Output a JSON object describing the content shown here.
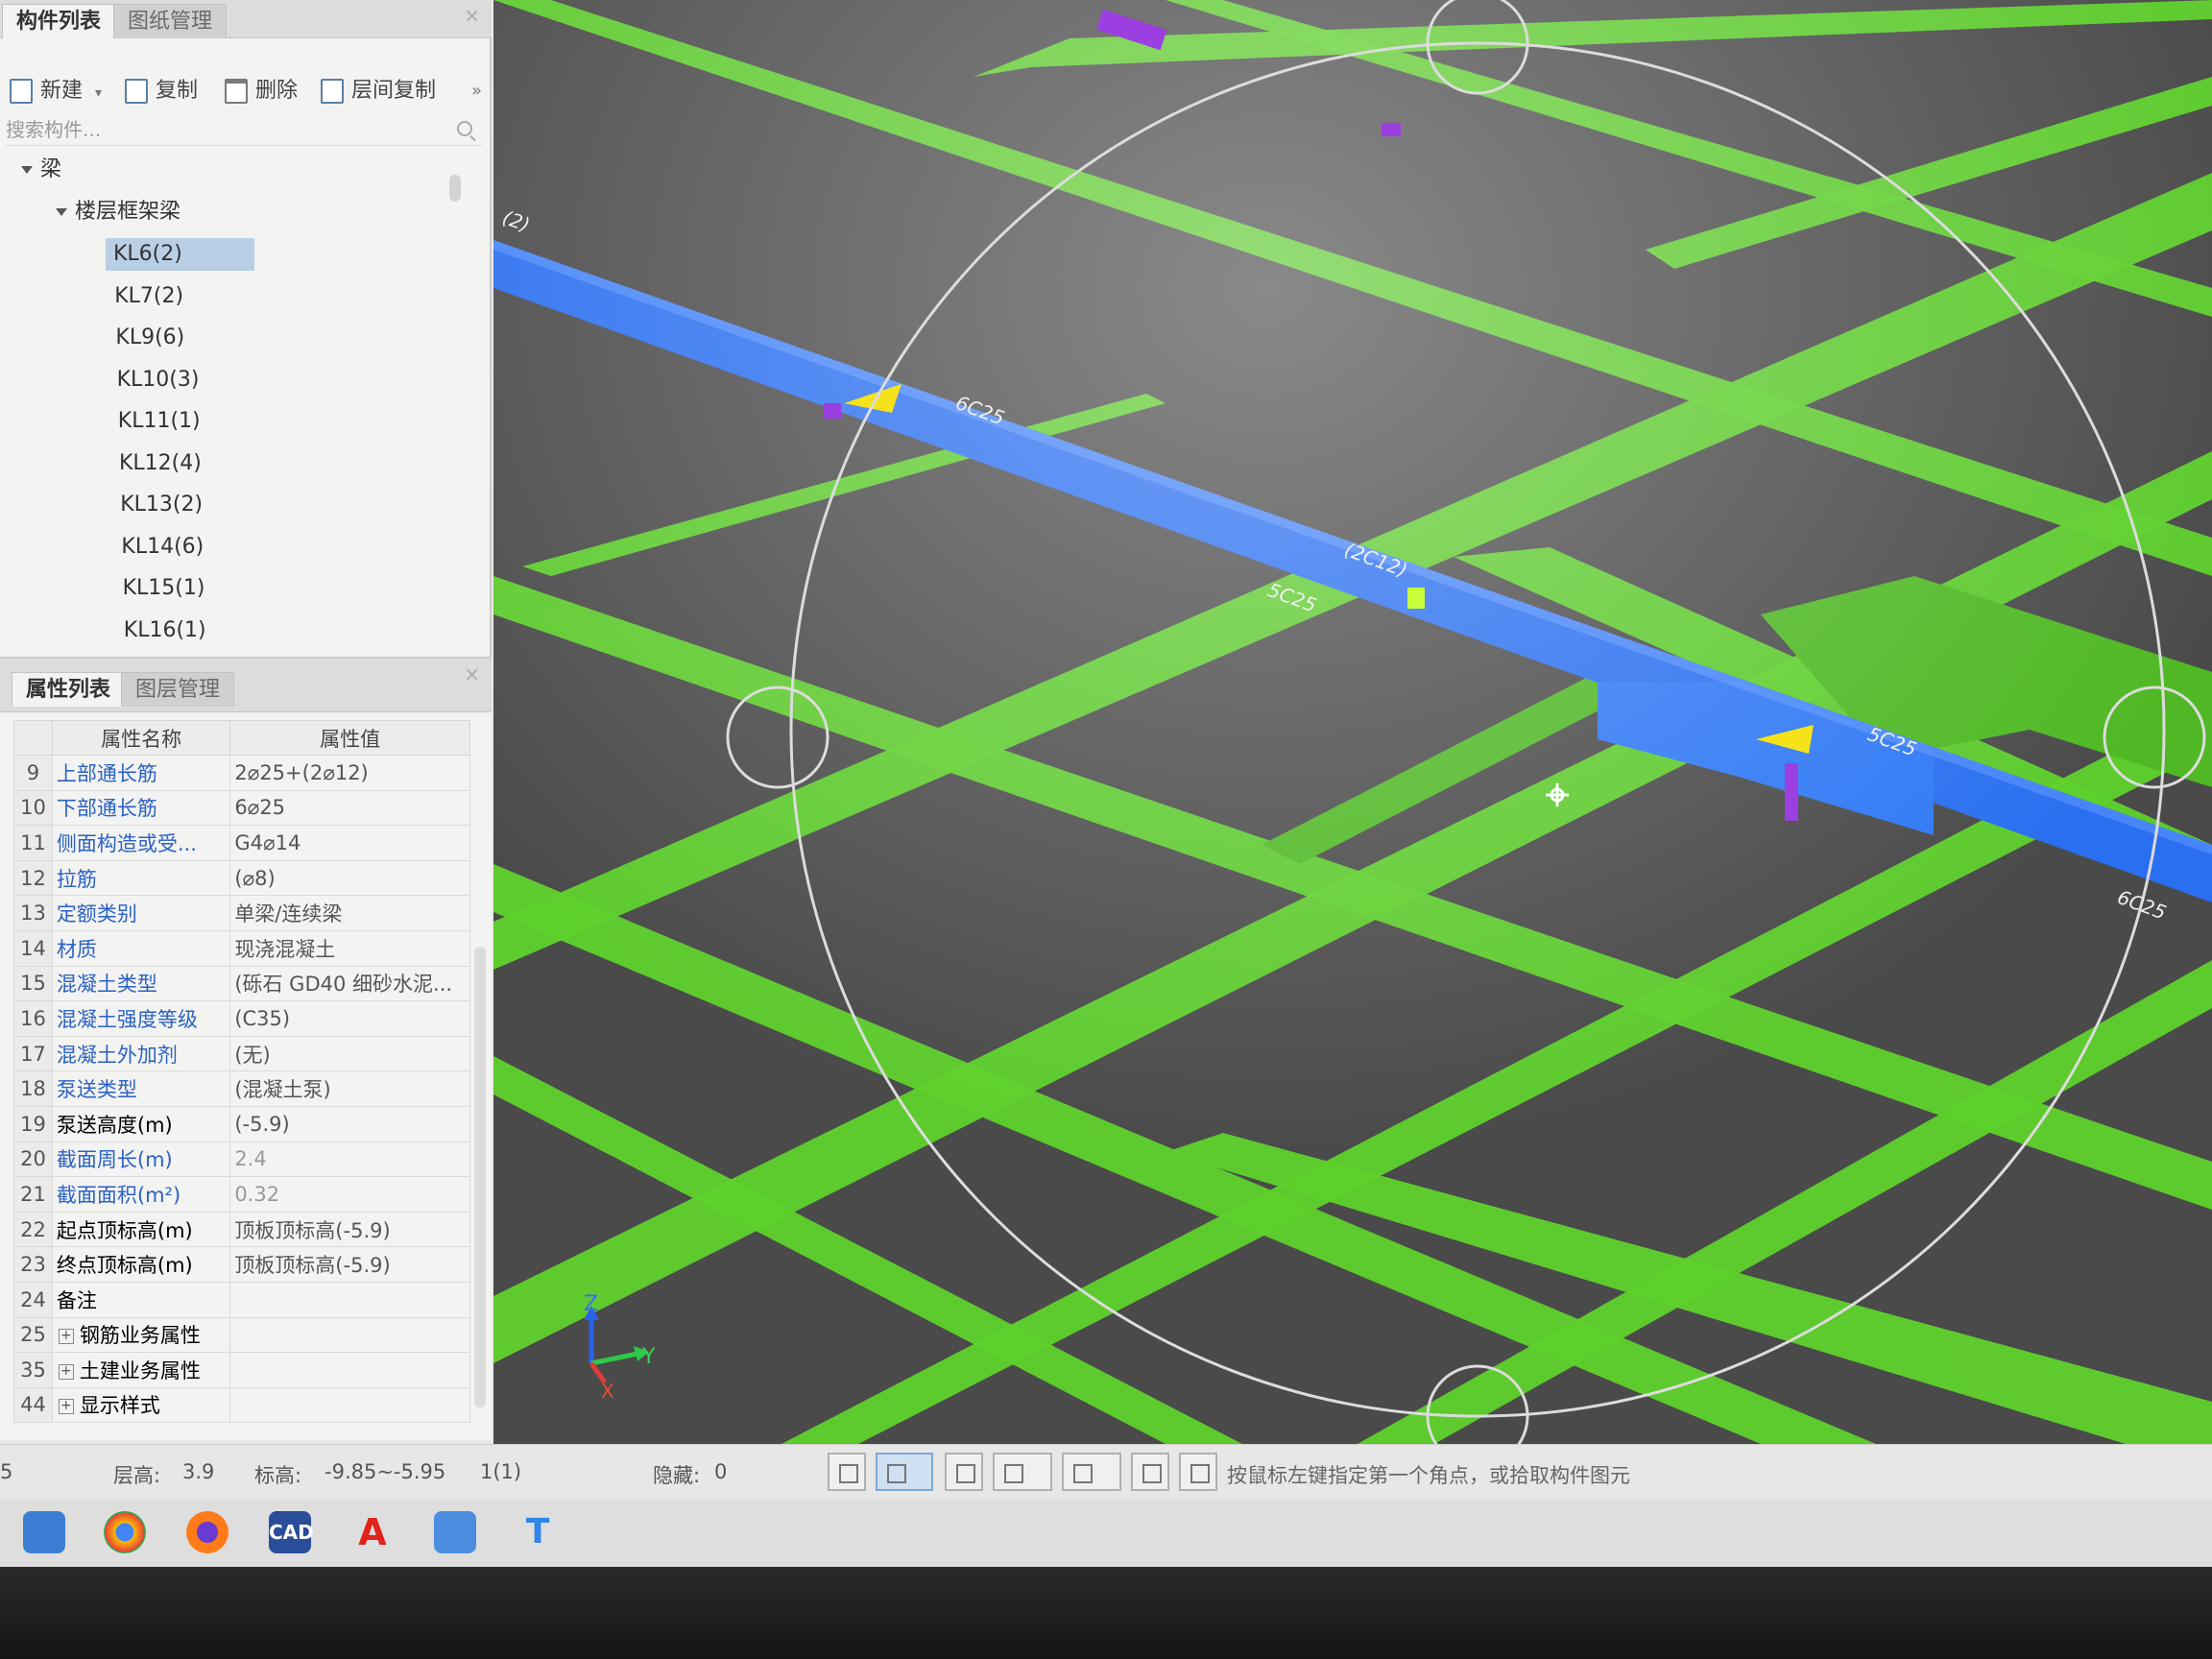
{
  "components_panel": {
    "tabs": [
      "构件列表",
      "图纸管理"
    ],
    "toolbar": {
      "new_label": "新建",
      "copy_label": "复制",
      "delete_label": "删除",
      "floor_copy_label": "层间复制"
    },
    "search_placeholder": "搜索构件...",
    "tree": {
      "root_label": "梁",
      "group_label": "楼层框架梁",
      "items": [
        "KL6(2)",
        "KL7(2)",
        "KL9(6)",
        "KL10(3)",
        "KL11(1)",
        "KL12(4)",
        "KL13(2)",
        "KL14(6)",
        "KL15(1)",
        "KL16(1)"
      ],
      "selected_index": 0
    }
  },
  "properties_panel": {
    "tabs": [
      "属性列表",
      "图层管理"
    ],
    "columns": [
      "属性名称",
      "属性值"
    ],
    "rows": [
      {
        "num": "9",
        "name": "上部通长筋",
        "value": "2⌀25+(2⌀12)",
        "link": true
      },
      {
        "num": "10",
        "name": "下部通长筋",
        "value": "6⌀25",
        "link": true
      },
      {
        "num": "11",
        "name": "侧面构造或受...",
        "value": "G4⌀14",
        "link": true
      },
      {
        "num": "12",
        "name": "拉筋",
        "value": "(⌀8)",
        "link": true
      },
      {
        "num": "13",
        "name": "定额类别",
        "value": "单梁/连续梁",
        "link": true
      },
      {
        "num": "14",
        "name": "材质",
        "value": "现浇混凝土",
        "link": true
      },
      {
        "num": "15",
        "name": "混凝土类型",
        "value": "(砾石 GD40 细砂水泥...",
        "link": true
      },
      {
        "num": "16",
        "name": "混凝土强度等级",
        "value": "(C35)",
        "link": true
      },
      {
        "num": "17",
        "name": "混凝土外加剂",
        "value": "(无)",
        "link": true
      },
      {
        "num": "18",
        "name": "泵送类型",
        "value": "(混凝土泵)",
        "link": true
      },
      {
        "num": "19",
        "name": "泵送高度(m)",
        "value": "(-5.9)",
        "link": false
      },
      {
        "num": "20",
        "name": "截面周长(m)",
        "value": "2.4",
        "link": true,
        "grey": true
      },
      {
        "num": "21",
        "name": "截面面积(m²)",
        "value": "0.32",
        "link": true,
        "grey": true
      },
      {
        "num": "22",
        "name": "起点顶标高(m)",
        "value": "顶板顶标高(-5.9)",
        "link": false
      },
      {
        "num": "23",
        "name": "终点顶标高(m)",
        "value": "顶板顶标高(-5.9)",
        "link": false
      },
      {
        "num": "24",
        "name": "备注",
        "value": "",
        "link": false
      },
      {
        "num": "25",
        "name": "钢筋业务属性",
        "value": "",
        "link": false,
        "group": true
      },
      {
        "num": "35",
        "name": "土建业务属性",
        "value": "",
        "link": false,
        "group": true
      },
      {
        "num": "44",
        "name": "显示样式",
        "value": "",
        "link": false,
        "group": true
      }
    ]
  },
  "viewport": {
    "beam_labels": [
      "6C25",
      "(2C12)",
      "5C25",
      "5C25",
      "6C25",
      "(2)"
    ],
    "axes": {
      "z": "Z",
      "y": "Y",
      "x": "X"
    },
    "colors": {
      "background": "#4a4a4a",
      "beam_green": "#5fd12c",
      "selected_beam_blue": "#2a6ff0",
      "marker_yellow": "#f5e21b",
      "marker_purple": "#9c3fe0"
    }
  },
  "status_bar": {
    "left_fragment": "5",
    "floor_height_label": "层高:",
    "floor_height_value": "3.9",
    "elevation_label": "标高:",
    "elevation_value": "-9.85~-5.95",
    "count": "1(1)",
    "hidden_label": "隐藏:",
    "hidden_value": "0",
    "hint": "按鼠标左键指定第一个角点，或拾取构件图元"
  },
  "taskbar": {
    "apps": [
      {
        "icon": "mail-icon",
        "label": ""
      },
      {
        "icon": "chrome-icon",
        "label": ""
      },
      {
        "icon": "firefox-icon",
        "label": ""
      },
      {
        "icon": "cad-icon",
        "label": "CAD"
      },
      {
        "icon": "acrobat-icon",
        "label": "A"
      },
      {
        "icon": "calculator-icon",
        "label": ""
      },
      {
        "icon": "text-tool-icon",
        "label": "T"
      }
    ]
  }
}
